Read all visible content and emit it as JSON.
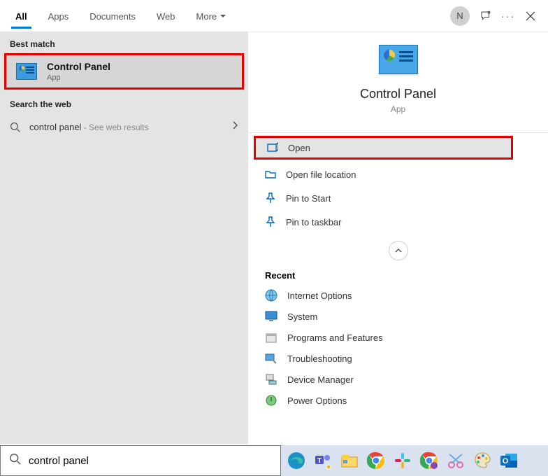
{
  "header": {
    "tabs": [
      "All",
      "Apps",
      "Documents",
      "Web",
      "More"
    ],
    "avatar_initial": "N"
  },
  "left": {
    "best_match_label": "Best match",
    "best_match": {
      "title": "Control Panel",
      "subtitle": "App"
    },
    "web_label": "Search the web",
    "web_query": "control panel",
    "web_hint": " - See web results"
  },
  "right": {
    "title": "Control Panel",
    "subtitle": "App",
    "actions": {
      "open": "Open",
      "open_file_location": "Open file location",
      "pin_start": "Pin to Start",
      "pin_taskbar": "Pin to taskbar"
    },
    "recent_label": "Recent",
    "recent": [
      "Internet Options",
      "System",
      "Programs and Features",
      "Troubleshooting",
      "Device Manager",
      "Power Options"
    ]
  },
  "search": {
    "value": "control panel"
  },
  "taskbar_icons": [
    "edge",
    "teams",
    "explorer",
    "chrome",
    "slack",
    "chrome2",
    "snip",
    "paint",
    "outlook"
  ]
}
